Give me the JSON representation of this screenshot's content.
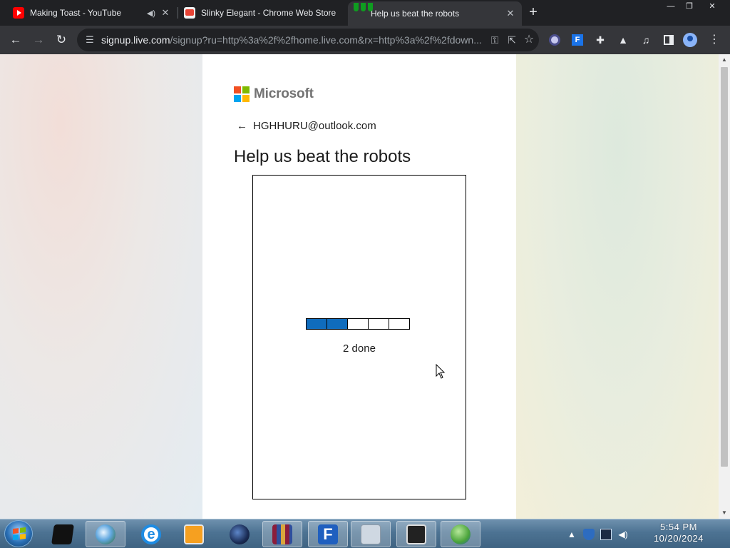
{
  "browser": {
    "tabs": [
      {
        "title": "Making Toast - YouTube",
        "favicon": "youtube-icon",
        "audio": true,
        "active": false
      },
      {
        "title": "Slinky Elegant - Chrome Web Store",
        "favicon": "chrome-web-store-icon",
        "active": false
      },
      {
        "title": "Help us beat the robots",
        "favicon": "microsoft-icon",
        "active": true
      }
    ],
    "address": {
      "host": "signup.live.com",
      "path": "/signup?ru=http%3a%2f%2fhome.live.com&rx=http%3a%2f%2fdown..."
    }
  },
  "page": {
    "brand": "Microsoft",
    "identity_email": "HGHHURU@outlook.com",
    "heading": "Help us beat the robots",
    "challenge": {
      "steps_total": 5,
      "steps_done": 2,
      "status_text": "2 done",
      "done_color": "#0f6cbd"
    }
  },
  "taskbar": {
    "apps": [
      "terminal-box-icon",
      "globe-icon",
      "internet-explorer-icon",
      "media-player-icon",
      "dark-orb-icon",
      "winrar-icon",
      "file-manager-icon",
      "documents-icon",
      "console-icon",
      "messenger-icon"
    ],
    "clock_time": "5:54 PM",
    "clock_date": "10/20/2024"
  }
}
